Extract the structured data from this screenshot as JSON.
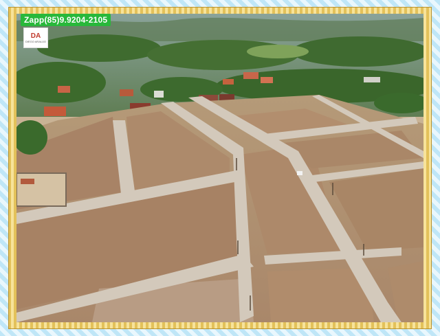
{
  "contact": {
    "whatsapp_text": "Zapp(85)9.9204-2105"
  },
  "logo": {
    "mark": "DA",
    "sub": "DIEGO ARAUJO"
  },
  "colors": {
    "frame_gold": "#e3c15a",
    "frame_blue": "#bfe6f7",
    "badge_green": "#28b83a"
  }
}
